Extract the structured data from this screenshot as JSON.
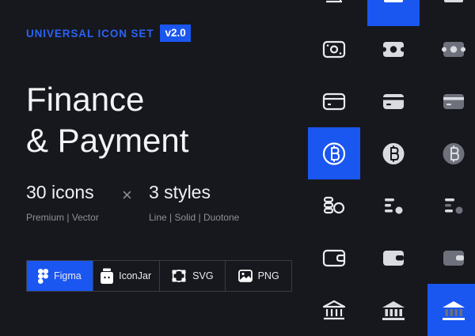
{
  "header": {
    "kicker": "UNIVERSAL ICON SET",
    "version": "v2.0"
  },
  "title": {
    "line1": "Finance",
    "line2": "& Payment"
  },
  "stats": {
    "icons": "30 icons",
    "times": "×",
    "styles": "3 styles",
    "icons_sub": "Premium | Vector",
    "styles_sub": "Line | Solid | Duotone"
  },
  "formats": [
    {
      "label": "Figma",
      "icon": "figma-icon"
    },
    {
      "label": "IconJar",
      "icon": "iconjar-icon"
    },
    {
      "label": "SVG",
      "icon": "svg-icon"
    },
    {
      "label": "PNG",
      "icon": "png-icon"
    }
  ],
  "colors": {
    "accent": "#1a56f0",
    "background": "#17181d",
    "icon_line": "#e9ebef",
    "icon_solid": "#d9dbe1",
    "icon_duo": "#6e717b"
  },
  "icon_rows": [
    {
      "name": "coin-stack",
      "styles": [
        "line",
        "solid",
        "duotone"
      ]
    },
    {
      "name": "banknote",
      "styles": [
        "line",
        "solid",
        "duotone"
      ]
    },
    {
      "name": "credit-card",
      "styles": [
        "line",
        "solid",
        "duotone"
      ]
    },
    {
      "name": "bitcoin",
      "styles": [
        "line",
        "solid",
        "duotone"
      ]
    },
    {
      "name": "coins-chart",
      "styles": [
        "line",
        "solid",
        "duotone"
      ]
    },
    {
      "name": "wallet",
      "styles": [
        "line",
        "solid",
        "duotone"
      ]
    },
    {
      "name": "bank",
      "styles": [
        "line",
        "solid",
        "duotone"
      ]
    }
  ]
}
